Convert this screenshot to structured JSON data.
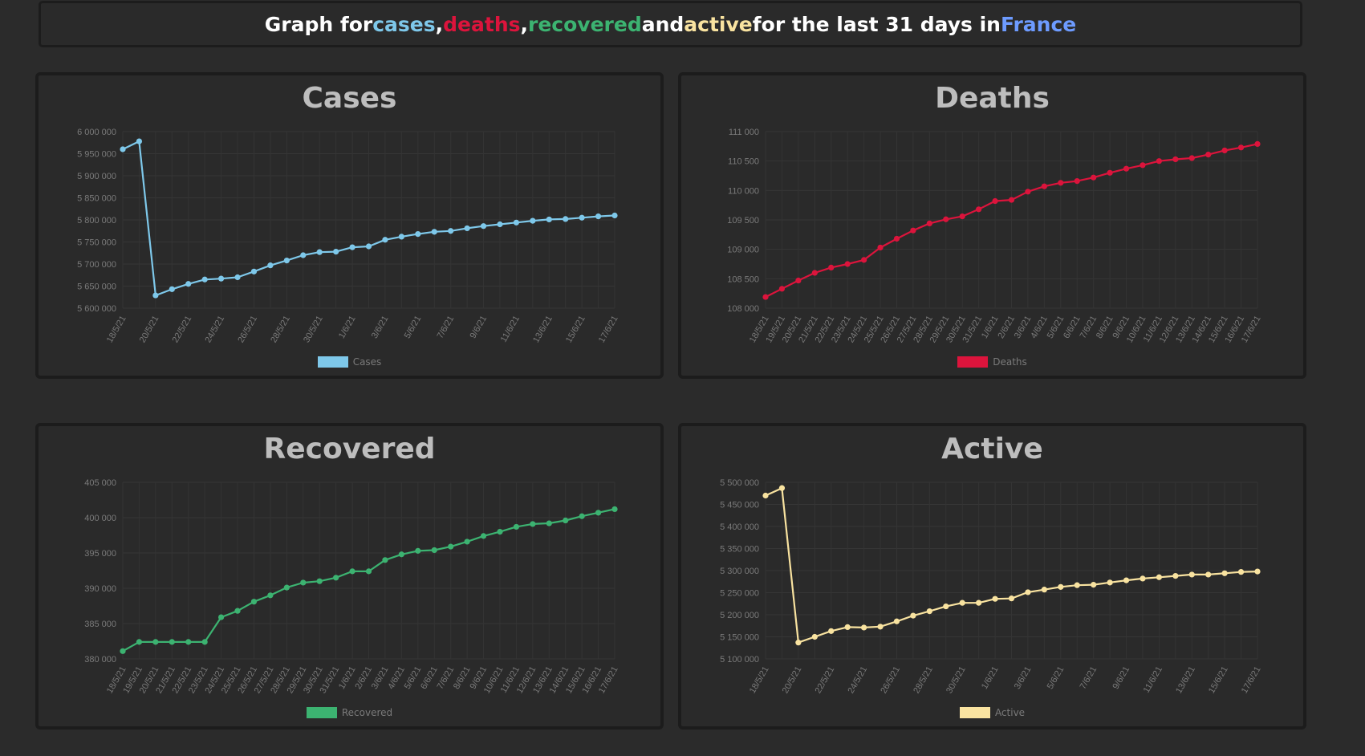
{
  "header": {
    "part1": "Graph for ",
    "cases": "cases",
    "sep1": ", ",
    "deaths": "deaths",
    "sep2": ", ",
    "recovered": "recovered",
    "and": " and ",
    "active": "active",
    "part2": " for the last 31 days in ",
    "country": "France"
  },
  "colors": {
    "cases": "#7ec8ea",
    "deaths": "#dc143c",
    "recovered": "#3cb371",
    "active": "#f9e3a0",
    "country": "#6d9bff"
  },
  "chart_data": [
    {
      "id": "cases",
      "type": "line",
      "title": "Cases",
      "legend": "Cases",
      "color": "#7ec8ea",
      "ylim": [
        5600000,
        6000000
      ],
      "yticks": [
        5600000,
        5650000,
        5700000,
        5750000,
        5800000,
        5850000,
        5900000,
        5950000,
        6000000
      ],
      "ytick_labels": [
        "5 600 000",
        "5 650 000",
        "5 700 000",
        "5 750 000",
        "5 800 000",
        "5 850 000",
        "5 900 000",
        "5 950 000",
        "6 000 000"
      ],
      "x": [
        "18/5/21",
        "19/5/21",
        "20/5/21",
        "21/5/21",
        "22/5/21",
        "23/5/21",
        "24/5/21",
        "25/5/21",
        "26/5/21",
        "27/5/21",
        "28/5/21",
        "29/5/21",
        "30/5/21",
        "31/5/21",
        "1/6/21",
        "2/6/21",
        "3/6/21",
        "4/6/21",
        "5/6/21",
        "6/6/21",
        "7/6/21",
        "8/6/21",
        "9/6/21",
        "10/6/21",
        "11/6/21",
        "12/6/21",
        "13/6/21",
        "14/6/21",
        "15/6/21",
        "16/6/21",
        "17/6/21"
      ],
      "xtick_step": 2,
      "values": [
        5960000,
        5978000,
        5629000,
        5643000,
        5655000,
        5665000,
        5667000,
        5670000,
        5683000,
        5697000,
        5708000,
        5720000,
        5727000,
        5728000,
        5738000,
        5740000,
        5755000,
        5762000,
        5768000,
        5773000,
        5775000,
        5781000,
        5786000,
        5790000,
        5794000,
        5798000,
        5801000,
        5802000,
        5805000,
        5808000,
        5810000
      ]
    },
    {
      "id": "deaths",
      "type": "line",
      "title": "Deaths",
      "legend": "Deaths",
      "color": "#dc143c",
      "ylim": [
        108000,
        111000
      ],
      "yticks": [
        108000,
        108500,
        109000,
        109500,
        110000,
        110500,
        111000
      ],
      "ytick_labels": [
        "108 000",
        "108 500",
        "109 000",
        "109 500",
        "110 000",
        "110 500",
        "111 000"
      ],
      "x": [
        "18/5/21",
        "19/5/21",
        "20/5/21",
        "21/5/21",
        "22/5/21",
        "23/5/21",
        "24/5/21",
        "25/5/21",
        "26/5/21",
        "27/5/21",
        "28/5/21",
        "29/5/21",
        "30/5/21",
        "31/5/21",
        "1/6/21",
        "2/6/21",
        "3/6/21",
        "4/6/21",
        "5/6/21",
        "6/6/21",
        "7/6/21",
        "8/6/21",
        "9/6/21",
        "10/6/21",
        "11/6/21",
        "12/6/21",
        "13/6/21",
        "14/6/21",
        "15/6/21",
        "16/6/21",
        "17/6/21"
      ],
      "xtick_step": 1,
      "values": [
        108190,
        108330,
        108470,
        108600,
        108690,
        108750,
        108820,
        109030,
        109180,
        109320,
        109440,
        109510,
        109560,
        109680,
        109820,
        109840,
        109980,
        110070,
        110130,
        110160,
        110220,
        110300,
        110370,
        110430,
        110500,
        110530,
        110550,
        110610,
        110680,
        110730,
        110790
      ]
    },
    {
      "id": "recovered",
      "type": "line",
      "title": "Recovered",
      "legend": "Recovered",
      "color": "#3cb371",
      "ylim": [
        380000,
        405000
      ],
      "yticks": [
        380000,
        385000,
        390000,
        395000,
        400000,
        405000
      ],
      "ytick_labels": [
        "380 000",
        "385 000",
        "390 000",
        "395 000",
        "400 000",
        "405 000"
      ],
      "x": [
        "18/5/21",
        "19/5/21",
        "20/5/21",
        "21/5/21",
        "22/5/21",
        "23/5/21",
        "24/5/21",
        "25/5/21",
        "26/5/21",
        "27/5/21",
        "28/5/21",
        "29/5/21",
        "30/5/21",
        "31/5/21",
        "1/6/21",
        "2/6/21",
        "3/6/21",
        "4/6/21",
        "5/6/21",
        "6/6/21",
        "7/6/21",
        "8/6/21",
        "9/6/21",
        "10/6/21",
        "11/6/21",
        "12/6/21",
        "13/6/21",
        "14/6/21",
        "15/6/21",
        "16/6/21",
        "17/6/21"
      ],
      "xtick_step": 1,
      "values": [
        381100,
        382400,
        382400,
        382400,
        382400,
        382400,
        385900,
        386800,
        388100,
        389000,
        390100,
        390800,
        391000,
        391500,
        392400,
        392400,
        394000,
        394800,
        395300,
        395400,
        395900,
        396600,
        397400,
        398000,
        398700,
        399100,
        399200,
        399600,
        400200,
        400700,
        401200
      ]
    },
    {
      "id": "active",
      "type": "line",
      "title": "Active",
      "legend": "Active",
      "color": "#f9e3a0",
      "ylim": [
        5100000,
        5500000
      ],
      "yticks": [
        5100000,
        5150000,
        5200000,
        5250000,
        5300000,
        5350000,
        5400000,
        5450000,
        5500000
      ],
      "ytick_labels": [
        "5 100 000",
        "5 150 000",
        "5 200 000",
        "5 250 000",
        "5 300 000",
        "5 350 000",
        "5 400 000",
        "5 450 000",
        "5 500 000"
      ],
      "x": [
        "18/5/21",
        "19/5/21",
        "20/5/21",
        "21/5/21",
        "22/5/21",
        "23/5/21",
        "24/5/21",
        "25/5/21",
        "26/5/21",
        "27/5/21",
        "28/5/21",
        "29/5/21",
        "30/5/21",
        "31/5/21",
        "1/6/21",
        "2/6/21",
        "3/6/21",
        "4/6/21",
        "5/6/21",
        "6/6/21",
        "7/6/21",
        "8/6/21",
        "9/6/21",
        "10/6/21",
        "11/6/21",
        "12/6/21",
        "13/6/21",
        "14/6/21",
        "15/6/21",
        "16/6/21",
        "17/6/21"
      ],
      "xtick_step": 2,
      "values": [
        5470000,
        5487000,
        5137000,
        5150000,
        5163000,
        5172000,
        5171000,
        5173000,
        5185000,
        5198000,
        5208000,
        5219000,
        5227000,
        5227000,
        5236000,
        5237000,
        5251000,
        5257000,
        5263000,
        5267000,
        5268000,
        5273000,
        5278000,
        5282000,
        5285000,
        5288000,
        5291000,
        5291000,
        5294000,
        5297000,
        5298000
      ]
    }
  ]
}
